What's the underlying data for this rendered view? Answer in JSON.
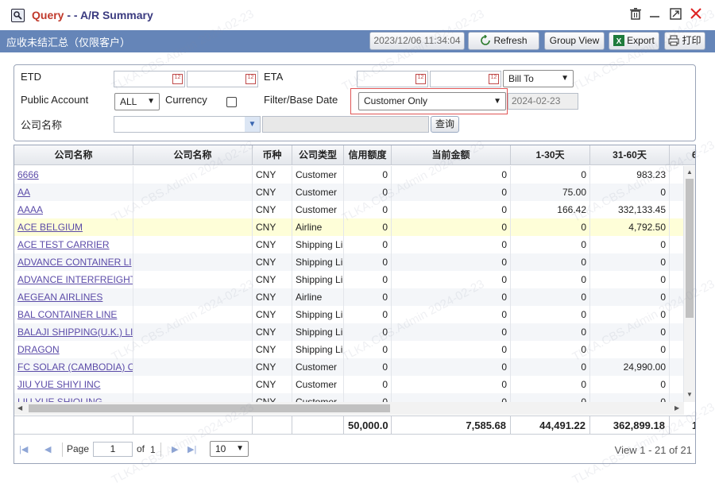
{
  "window": {
    "title_prefix": "Query",
    "title_main": " - - A/R Summary"
  },
  "toolbar": {
    "title": "应收未结汇总（仅限客户）",
    "timestamp": "2023/12/06 11:34:04",
    "refresh": "Refresh",
    "group_view": "Group View",
    "export": "Export",
    "print": "打印"
  },
  "filter": {
    "etd_label": "ETD",
    "eta_label": "ETA",
    "public_account_label": "Public Account",
    "public_account_value": "ALL",
    "currency_label": "Currency",
    "filter_base_date_label": "Filter/Base Date",
    "filter_base_date_value": "Customer Only",
    "bill_to_value": "Bill To",
    "base_date": "2024-02-23",
    "company_name_label": "公司名称",
    "query_button": "查询"
  },
  "grid": {
    "columns": [
      "公司名称",
      "公司名称",
      "币种",
      "公司类型",
      "信用额度",
      "当前金额",
      "1-30天",
      "31-60天",
      "6"
    ],
    "rows": [
      {
        "company": "6666",
        "company2": "",
        "currency": "CNY",
        "type": "Customer",
        "credit": "0",
        "current": "0",
        "d1_30": "0",
        "d31_60": "983.23"
      },
      {
        "company": "AA",
        "company2": "",
        "currency": "CNY",
        "type": "Customer",
        "credit": "0",
        "current": "0",
        "d1_30": "75.00",
        "d31_60": "0"
      },
      {
        "company": "AAAA",
        "company2": "",
        "currency": "CNY",
        "type": "Customer",
        "credit": "0",
        "current": "0",
        "d1_30": "166.42",
        "d31_60": "332,133.45"
      },
      {
        "company": "ACE BELGIUM",
        "company2": "",
        "currency": "CNY",
        "type": "Airline",
        "credit": "0",
        "current": "0",
        "d1_30": "0",
        "d31_60": "4,792.50"
      },
      {
        "company": "ACE TEST CARRIER",
        "company2": "",
        "currency": "CNY",
        "type": "Shipping Li",
        "credit": "0",
        "current": "0",
        "d1_30": "0",
        "d31_60": "0"
      },
      {
        "company": "ADVANCE CONTAINER LI",
        "company2": "",
        "currency": "CNY",
        "type": "Shipping Li",
        "credit": "0",
        "current": "0",
        "d1_30": "0",
        "d31_60": "0"
      },
      {
        "company": "ADVANCE INTERFREIGHT",
        "company2": "",
        "currency": "CNY",
        "type": "Shipping Li",
        "credit": "0",
        "current": "0",
        "d1_30": "0",
        "d31_60": "0"
      },
      {
        "company": "AEGEAN AIRLINES",
        "company2": "",
        "currency": "CNY",
        "type": "Airline",
        "credit": "0",
        "current": "0",
        "d1_30": "0",
        "d31_60": "0"
      },
      {
        "company": "BAL CONTAINER LINE",
        "company2": "",
        "currency": "CNY",
        "type": "Shipping Li",
        "credit": "0",
        "current": "0",
        "d1_30": "0",
        "d31_60": "0"
      },
      {
        "company": "BALAJI SHIPPING(U.K.) LI",
        "company2": "",
        "currency": "CNY",
        "type": "Shipping Li",
        "credit": "0",
        "current": "0",
        "d1_30": "0",
        "d31_60": "0"
      },
      {
        "company": "DRAGON",
        "company2": "",
        "currency": "CNY",
        "type": "Shipping Li",
        "credit": "0",
        "current": "0",
        "d1_30": "0",
        "d31_60": "0"
      },
      {
        "company": "FC SOLAR (CAMBODIA) C",
        "company2": "",
        "currency": "CNY",
        "type": "Customer",
        "credit": "0",
        "current": "0",
        "d1_30": "0",
        "d31_60": "24,990.00"
      },
      {
        "company": "JIU YUE SHIYI INC",
        "company2": "",
        "currency": "CNY",
        "type": "Customer",
        "credit": "0",
        "current": "0",
        "d1_30": "0",
        "d31_60": "0"
      },
      {
        "company": "LIU YUE SHIQLING",
        "company2": "",
        "currency": "CNY",
        "type": "Customer",
        "credit": "0",
        "current": "0",
        "d1_30": "0",
        "d31_60": "0"
      }
    ],
    "totals": {
      "credit": "50,000.0",
      "current": "7,585.68",
      "d1_30": "44,491.22",
      "d31_60": "362,899.18",
      "d61": "1"
    }
  },
  "pager": {
    "page_label": "Page",
    "page_value": "1",
    "of_label": "of",
    "total_pages": "1",
    "page_size": "10",
    "view_info": "View 1 - 21 of 21"
  },
  "watermark": "TLKA.CBS.Admin 2024-02-23",
  "colors": {
    "toolbar_bg": "#6585b8",
    "title_accent": "#c0392b",
    "link": "#5b4ba8",
    "highlight_row": "#fefed8",
    "focus_border": "#e05555"
  }
}
